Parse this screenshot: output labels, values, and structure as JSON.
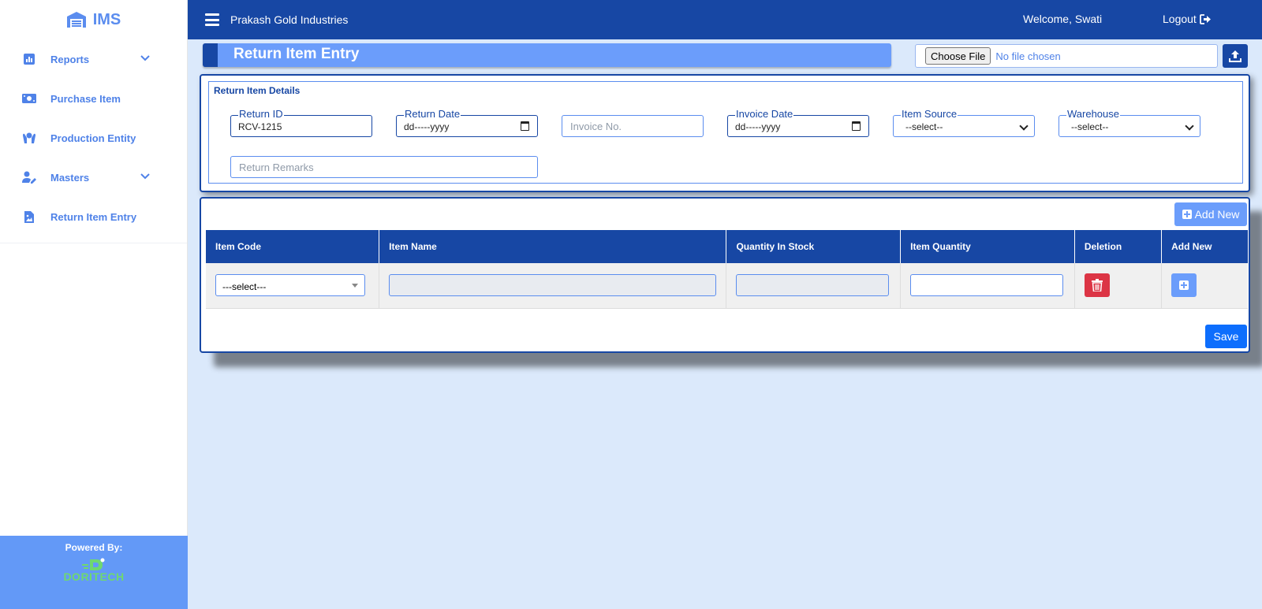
{
  "brand": {
    "name": "IMS"
  },
  "sidebar": {
    "items": [
      {
        "label": "Reports",
        "icon": "bar-chart-icon",
        "has_chevron": true
      },
      {
        "label": "Purchase Item",
        "icon": "money-icon",
        "has_chevron": false
      },
      {
        "label": "Production Entity",
        "icon": "hand-holding-icon",
        "has_chevron": false
      },
      {
        "label": "Masters",
        "icon": "user-edit-icon",
        "has_chevron": true
      },
      {
        "label": "Return Item Entry",
        "icon": "file-image-icon",
        "has_chevron": false
      }
    ],
    "powered_by": "Powered By:",
    "powered_logo_text": "DORITECH"
  },
  "topbar": {
    "company": "Prakash Gold Industries",
    "welcome": "Welcome, Swati",
    "logout": "Logout"
  },
  "page": {
    "title": "Return Item Entry",
    "file_choose": "Choose File",
    "file_status": "No file chosen"
  },
  "details": {
    "legend": "Return Item Details",
    "return_id_label": "Return ID",
    "return_id_value": "RCV-1215",
    "return_date_label": "Return Date",
    "return_date_value": "dd-----yyyy",
    "invoice_no_placeholder": "Invoice No.",
    "invoice_date_label": "Invoice Date",
    "invoice_date_value": "dd-----yyyy",
    "item_source_label": "Item Source",
    "item_source_value": "--select--",
    "warehouse_label": "Warehouse",
    "warehouse_value": "--select--",
    "remarks_placeholder": "Return Remarks"
  },
  "items": {
    "add_new": "Add New",
    "columns": [
      "Item Code",
      "Item Name",
      "Quantity In Stock",
      "Item Quantity",
      "Deletion",
      "Add New"
    ],
    "row": {
      "item_code": "---select---"
    },
    "save": "Save"
  },
  "colors": {
    "primary": "#1747a4",
    "accent": "#6b9dfb",
    "danger": "#dc3545",
    "save": "#0d6efd",
    "background": "#dbe9fb"
  }
}
